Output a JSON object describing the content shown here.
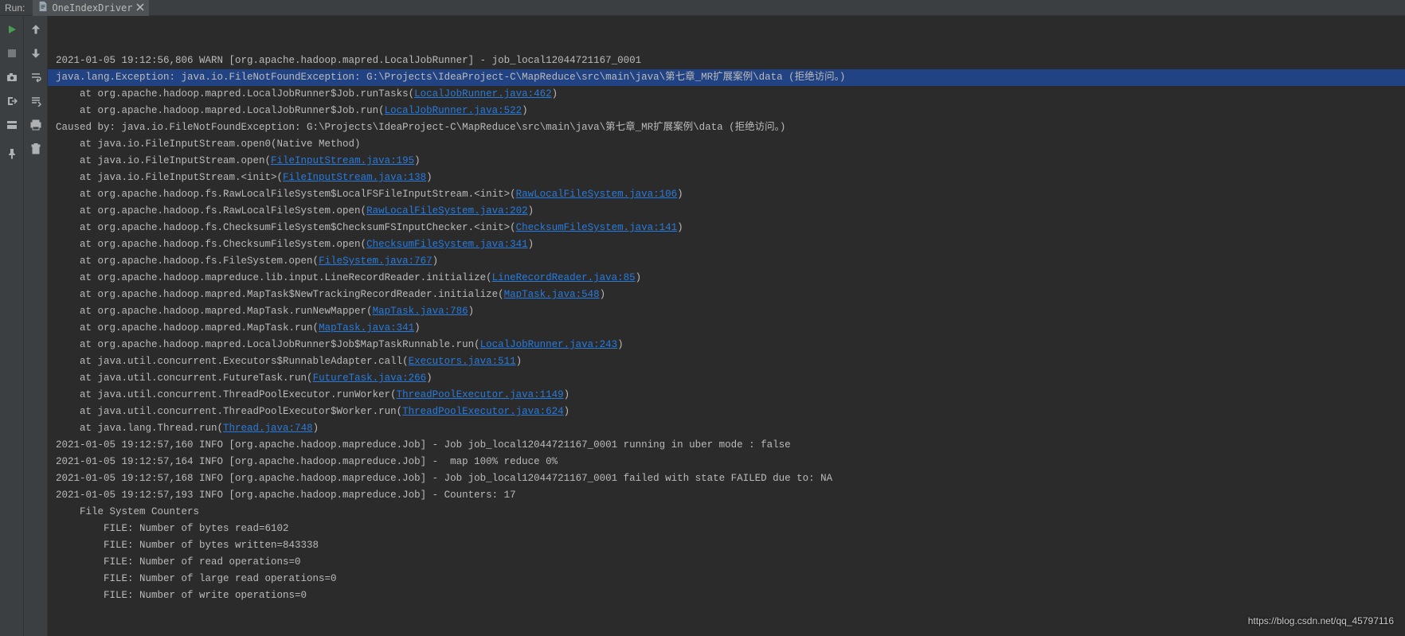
{
  "topbar": {
    "run_label": "Run:",
    "tab_name": "OneIndexDriver"
  },
  "watermark": "https://blog.csdn.net/qq_45797116",
  "lines": [
    {
      "t": "plain",
      "text": "2021-01-05 19:12:56,806 WARN [org.apache.hadoop.mapred.LocalJobRunner] - job_local12044721167_0001"
    },
    {
      "t": "highlight",
      "text": "java.lang.Exception: java.io.FileNotFoundException: G:\\Projects\\IdeaProject-C\\MapReduce\\src\\main\\java\\第七章_MR扩展案例\\data (拒绝访问。)"
    },
    {
      "t": "at",
      "pre": "    at org.apache.hadoop.mapred.LocalJobRunner$Job.runTasks(",
      "link": "LocalJobRunner.java:462",
      "post": ")"
    },
    {
      "t": "at",
      "pre": "    at org.apache.hadoop.mapred.LocalJobRunner$Job.run(",
      "link": "LocalJobRunner.java:522",
      "post": ")"
    },
    {
      "t": "plain",
      "text": "Caused by: java.io.FileNotFoundException: G:\\Projects\\IdeaProject-C\\MapReduce\\src\\main\\java\\第七章_MR扩展案例\\data (拒绝访问。)"
    },
    {
      "t": "plain",
      "text": "    at java.io.FileInputStream.open0(Native Method)"
    },
    {
      "t": "at",
      "pre": "    at java.io.FileInputStream.open(",
      "link": "FileInputStream.java:195",
      "post": ")"
    },
    {
      "t": "at",
      "pre": "    at java.io.FileInputStream.<init>(",
      "link": "FileInputStream.java:138",
      "post": ")"
    },
    {
      "t": "at",
      "pre": "    at org.apache.hadoop.fs.RawLocalFileSystem$LocalFSFileInputStream.<init>(",
      "link": "RawLocalFileSystem.java:106",
      "post": ")"
    },
    {
      "t": "at",
      "pre": "    at org.apache.hadoop.fs.RawLocalFileSystem.open(",
      "link": "RawLocalFileSystem.java:202",
      "post": ")"
    },
    {
      "t": "at",
      "pre": "    at org.apache.hadoop.fs.ChecksumFileSystem$ChecksumFSInputChecker.<init>(",
      "link": "ChecksumFileSystem.java:141",
      "post": ")"
    },
    {
      "t": "at",
      "pre": "    at org.apache.hadoop.fs.ChecksumFileSystem.open(",
      "link": "ChecksumFileSystem.java:341",
      "post": ")"
    },
    {
      "t": "at",
      "pre": "    at org.apache.hadoop.fs.FileSystem.open(",
      "link": "FileSystem.java:767",
      "post": ")"
    },
    {
      "t": "at",
      "pre": "    at org.apache.hadoop.mapreduce.lib.input.LineRecordReader.initialize(",
      "link": "LineRecordReader.java:85",
      "post": ")"
    },
    {
      "t": "at",
      "pre": "    at org.apache.hadoop.mapred.MapTask$NewTrackingRecordReader.initialize(",
      "link": "MapTask.java:548",
      "post": ")"
    },
    {
      "t": "at",
      "pre": "    at org.apache.hadoop.mapred.MapTask.runNewMapper(",
      "link": "MapTask.java:786",
      "post": ")"
    },
    {
      "t": "at",
      "pre": "    at org.apache.hadoop.mapred.MapTask.run(",
      "link": "MapTask.java:341",
      "post": ")"
    },
    {
      "t": "at",
      "pre": "    at org.apache.hadoop.mapred.LocalJobRunner$Job$MapTaskRunnable.run(",
      "link": "LocalJobRunner.java:243",
      "post": ")"
    },
    {
      "t": "at",
      "pre": "    at java.util.concurrent.Executors$RunnableAdapter.call(",
      "link": "Executors.java:511",
      "post": ")"
    },
    {
      "t": "at",
      "pre": "    at java.util.concurrent.FutureTask.run(",
      "link": "FutureTask.java:266",
      "post": ")"
    },
    {
      "t": "at",
      "pre": "    at java.util.concurrent.ThreadPoolExecutor.runWorker(",
      "link": "ThreadPoolExecutor.java:1149",
      "post": ")"
    },
    {
      "t": "at",
      "pre": "    at java.util.concurrent.ThreadPoolExecutor$Worker.run(",
      "link": "ThreadPoolExecutor.java:624",
      "post": ")"
    },
    {
      "t": "at",
      "pre": "    at java.lang.Thread.run(",
      "link": "Thread.java:748",
      "post": ")"
    },
    {
      "t": "plain",
      "text": "2021-01-05 19:12:57,160 INFO [org.apache.hadoop.mapreduce.Job] - Job job_local12044721167_0001 running in uber mode : false"
    },
    {
      "t": "plain",
      "text": "2021-01-05 19:12:57,164 INFO [org.apache.hadoop.mapreduce.Job] -  map 100% reduce 0%"
    },
    {
      "t": "plain",
      "text": "2021-01-05 19:12:57,168 INFO [org.apache.hadoop.mapreduce.Job] - Job job_local12044721167_0001 failed with state FAILED due to: NA"
    },
    {
      "t": "plain",
      "text": "2021-01-05 19:12:57,193 INFO [org.apache.hadoop.mapreduce.Job] - Counters: 17"
    },
    {
      "t": "plain",
      "text": "    File System Counters"
    },
    {
      "t": "plain",
      "text": "        FILE: Number of bytes read=6102"
    },
    {
      "t": "plain",
      "text": "        FILE: Number of bytes written=843338"
    },
    {
      "t": "plain",
      "text": "        FILE: Number of read operations=0"
    },
    {
      "t": "plain",
      "text": "        FILE: Number of large read operations=0"
    },
    {
      "t": "plain",
      "text": "        FILE: Number of write operations=0"
    }
  ]
}
